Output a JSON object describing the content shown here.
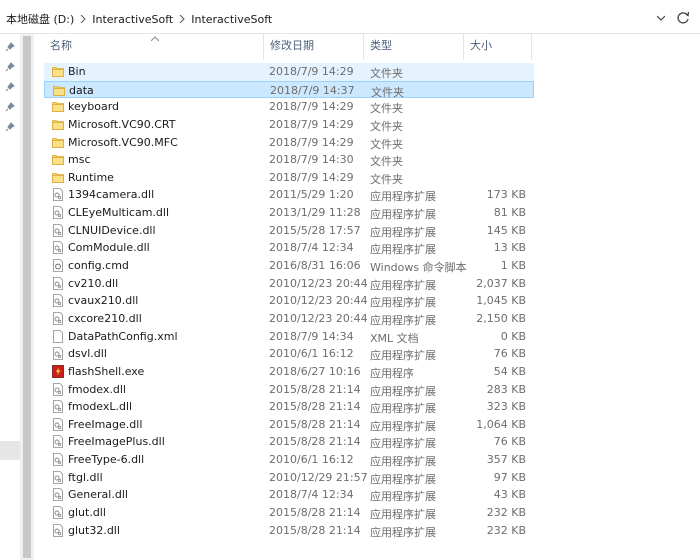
{
  "address": {
    "segments": [
      "本地磁盘 (D:)",
      "InteractiveSoft",
      "InteractiveSoft"
    ],
    "separator_icon": "chevron-right-icon",
    "dropdown_icon": "chevron-down-icon",
    "refresh_icon": "refresh-icon"
  },
  "columns": {
    "name": "名称",
    "date": "修改日期",
    "type": "类型",
    "size": "大小"
  },
  "colors": {
    "selected_row": "#cce8ff",
    "hover_row": "#e5f3ff",
    "folder": "#f7d26a",
    "header_text": "#4c607a",
    "meta_text": "#6d6d6d"
  },
  "files": [
    {
      "name": "Bin",
      "date": "2018/7/9 14:29",
      "type": "文件夹",
      "size": "",
      "icon": "folder-icon",
      "state": "hover"
    },
    {
      "name": "data",
      "date": "2018/7/9 14:37",
      "type": "文件夹",
      "size": "",
      "icon": "folder-icon",
      "state": "selected"
    },
    {
      "name": "keyboard",
      "date": "2018/7/9 14:29",
      "type": "文件夹",
      "size": "",
      "icon": "folder-icon"
    },
    {
      "name": "Microsoft.VC90.CRT",
      "date": "2018/7/9 14:29",
      "type": "文件夹",
      "size": "",
      "icon": "folder-icon"
    },
    {
      "name": "Microsoft.VC90.MFC",
      "date": "2018/7/9 14:29",
      "type": "文件夹",
      "size": "",
      "icon": "folder-icon"
    },
    {
      "name": "msc",
      "date": "2018/7/9 14:30",
      "type": "文件夹",
      "size": "",
      "icon": "folder-icon"
    },
    {
      "name": "Runtime",
      "date": "2018/7/9 14:29",
      "type": "文件夹",
      "size": "",
      "icon": "folder-icon"
    },
    {
      "name": "1394camera.dll",
      "date": "2011/5/29 1:20",
      "type": "应用程序扩展",
      "size": "173 KB",
      "icon": "dll-file-icon"
    },
    {
      "name": "CLEyeMulticam.dll",
      "date": "2013/1/29 11:28",
      "type": "应用程序扩展",
      "size": "81 KB",
      "icon": "dll-file-icon"
    },
    {
      "name": "CLNUIDevice.dll",
      "date": "2015/5/28 17:57",
      "type": "应用程序扩展",
      "size": "145 KB",
      "icon": "dll-file-icon"
    },
    {
      "name": "ComModule.dll",
      "date": "2018/7/4 12:34",
      "type": "应用程序扩展",
      "size": "13 KB",
      "icon": "dll-file-icon"
    },
    {
      "name": "config.cmd",
      "date": "2016/8/31 16:06",
      "type": "Windows 命令脚本",
      "size": "1 KB",
      "icon": "cmd-file-icon"
    },
    {
      "name": "cv210.dll",
      "date": "2010/12/23 20:44",
      "type": "应用程序扩展",
      "size": "2,037 KB",
      "icon": "dll-file-icon"
    },
    {
      "name": "cvaux210.dll",
      "date": "2010/12/23 20:44",
      "type": "应用程序扩展",
      "size": "1,045 KB",
      "icon": "dll-file-icon"
    },
    {
      "name": "cxcore210.dll",
      "date": "2010/12/23 20:44",
      "type": "应用程序扩展",
      "size": "2,150 KB",
      "icon": "dll-file-icon"
    },
    {
      "name": "DataPathConfig.xml",
      "date": "2018/7/9 14:34",
      "type": "XML 文档",
      "size": "0 KB",
      "icon": "xml-file-icon"
    },
    {
      "name": "dsvl.dll",
      "date": "2010/6/1 16:12",
      "type": "应用程序扩展",
      "size": "76 KB",
      "icon": "dll-file-icon"
    },
    {
      "name": "flashShell.exe",
      "date": "2018/6/27 10:16",
      "type": "应用程序",
      "size": "54 KB",
      "icon": "exe-app-icon"
    },
    {
      "name": "fmodex.dll",
      "date": "2015/8/28 21:14",
      "type": "应用程序扩展",
      "size": "283 KB",
      "icon": "dll-file-icon"
    },
    {
      "name": "fmodexL.dll",
      "date": "2015/8/28 21:14",
      "type": "应用程序扩展",
      "size": "323 KB",
      "icon": "dll-file-icon"
    },
    {
      "name": "FreeImage.dll",
      "date": "2015/8/28 21:14",
      "type": "应用程序扩展",
      "size": "1,064 KB",
      "icon": "dll-file-icon"
    },
    {
      "name": "FreeImagePlus.dll",
      "date": "2015/8/28 21:14",
      "type": "应用程序扩展",
      "size": "76 KB",
      "icon": "dll-file-icon"
    },
    {
      "name": "FreeType-6.dll",
      "date": "2010/6/1 16:12",
      "type": "应用程序扩展",
      "size": "357 KB",
      "icon": "dll-file-icon"
    },
    {
      "name": "ftgl.dll",
      "date": "2010/12/29 21:57",
      "type": "应用程序扩展",
      "size": "97 KB",
      "icon": "dll-file-icon"
    },
    {
      "name": "General.dll",
      "date": "2018/7/4 12:34",
      "type": "应用程序扩展",
      "size": "43 KB",
      "icon": "dll-file-icon"
    },
    {
      "name": "glut.dll",
      "date": "2015/8/28 21:14",
      "type": "应用程序扩展",
      "size": "232 KB",
      "icon": "dll-file-icon"
    },
    {
      "name": "glut32.dll",
      "date": "2015/8/28 21:14",
      "type": "应用程序扩展",
      "size": "232 KB",
      "icon": "dll-file-icon"
    }
  ]
}
